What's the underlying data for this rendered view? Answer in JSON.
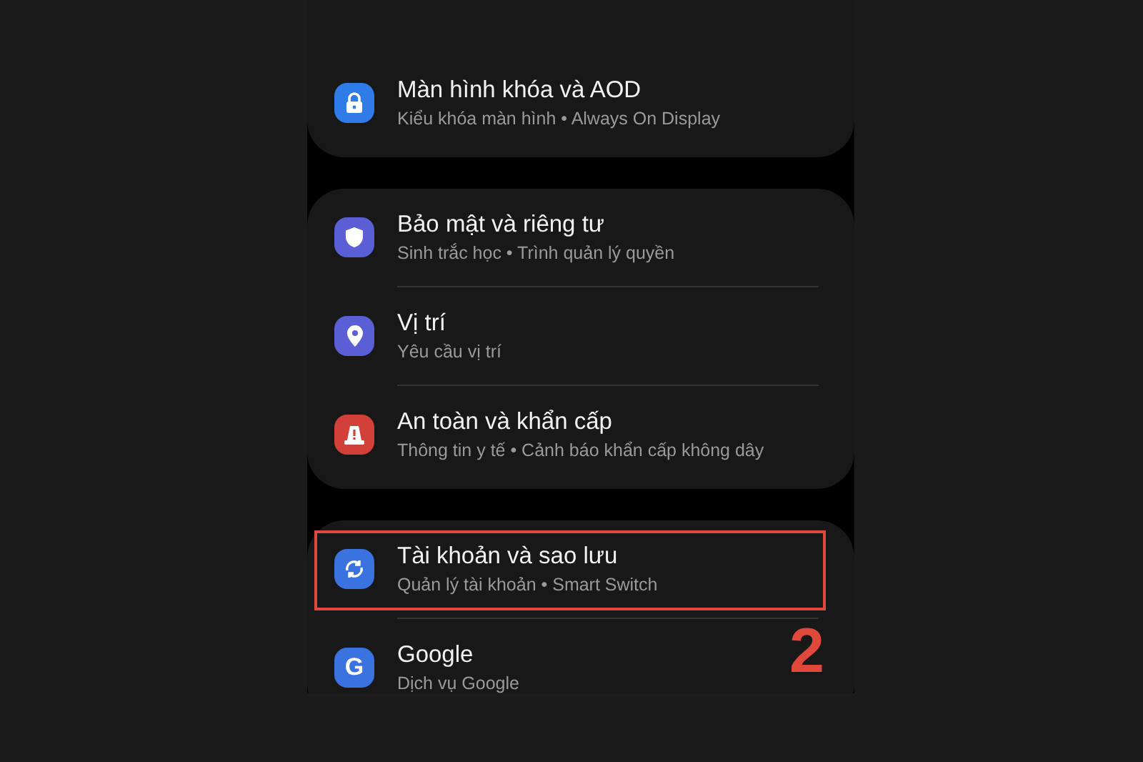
{
  "sections": [
    {
      "items": [
        {
          "kind": "lock",
          "color": "#2f7be8",
          "title": "Màn hình khóa và AOD",
          "subtitle": "Kiểu khóa màn hình • Always On Display",
          "highlighted": false
        }
      ]
    },
    {
      "items": [
        {
          "kind": "shield",
          "color": "#5b5fd6",
          "title": "Bảo mật và riêng tư",
          "subtitle": "Sinh trắc học • Trình quản lý quyền",
          "highlighted": false
        },
        {
          "kind": "pin",
          "color": "#5b5fd6",
          "title": "Vị trí",
          "subtitle": "Yêu cầu vị trí",
          "highlighted": false
        },
        {
          "kind": "alert",
          "color": "#d2403a",
          "title": "An toàn và khẩn cấp",
          "subtitle": "Thông tin y tế • Cảnh báo khẩn cấp không dây",
          "highlighted": false
        }
      ]
    },
    {
      "items": [
        {
          "kind": "sync",
          "color": "#3a72e0",
          "title": "Tài khoản và sao lưu",
          "subtitle": "Quản lý tài khoản • Smart Switch",
          "highlighted": true
        },
        {
          "kind": "letter",
          "glyph": "G",
          "color": "#3a72e0",
          "title": "Google",
          "subtitle": "Dịch vụ Google",
          "highlighted": false
        }
      ]
    }
  ],
  "annotation": {
    "label": "2"
  }
}
